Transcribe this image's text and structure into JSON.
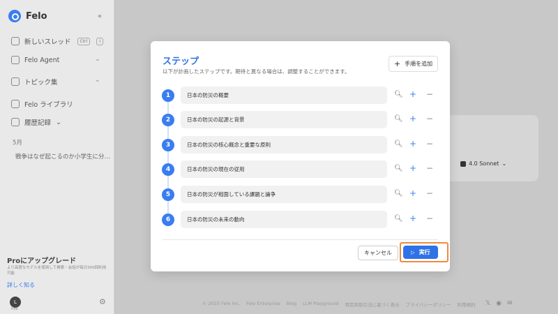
{
  "brand": {
    "name": "Felo"
  },
  "sidebar": {
    "new_thread_label": "新しいスレッド",
    "kbd_ctrl": "Ctrl",
    "kbd_i": "I",
    "felo_agent_label": "Felo Agent",
    "topics_label": "トピック集",
    "library_label": "Felo ライブラリ",
    "history_label": "履歴記録",
    "month_label": "5月",
    "history_item": "戦争はなぜ起こるのか小学生に分…",
    "upgrade_title": "Proにアップグレード",
    "upgrade_desc": "より高度なモデルを使用して検索・会話が毎日300回利用可能",
    "upgrade_link": "詳しく知る",
    "avatar_letter": "L",
    "avatar_badge": "Free"
  },
  "background": {
    "model_label": "4.0 Sonnet",
    "footer": [
      "© 2025 Felo Inc.",
      "Felo Enterprise",
      "Blog",
      "LLM Playground",
      "特定商取引法に基づく表示",
      "プライバシーポリシー",
      "利用規約"
    ]
  },
  "modal": {
    "title": "ステップ",
    "subtitle": "以下が計画したステップです。期待と異なる場合は、調整することができます。",
    "add_step_label": "手順を追加",
    "steps": [
      {
        "num": "1",
        "text": "日本の防災の概要"
      },
      {
        "num": "2",
        "text": "日本の防災の起源と背景"
      },
      {
        "num": "3",
        "text": "日本の防災の核心概念と重要な原則"
      },
      {
        "num": "4",
        "text": "日本の防災の現在の従用"
      },
      {
        "num": "5",
        "text": "日本の防災が相面している課題と論争"
      },
      {
        "num": "6",
        "text": "日本の防災の未来の動向"
      }
    ],
    "cancel_label": "キャンセル",
    "run_label": "実行"
  },
  "colors": {
    "accent": "#2f72e6",
    "highlight": "#f08a3c"
  }
}
